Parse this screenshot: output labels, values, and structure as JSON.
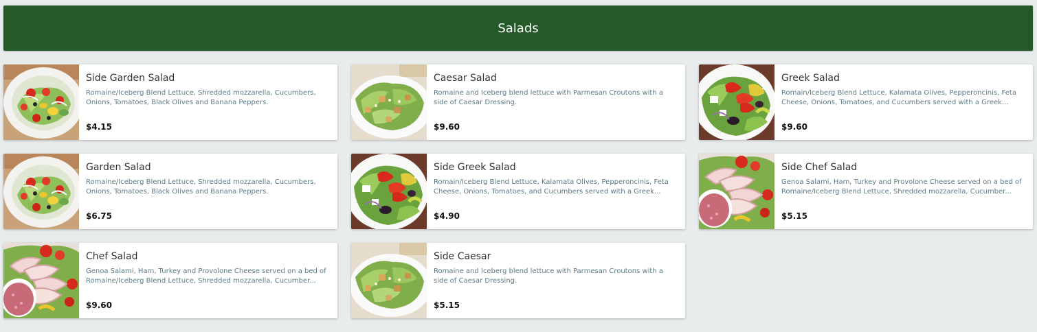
{
  "header": {
    "title": "Salads"
  },
  "items": [
    {
      "name": "Side Garden Salad",
      "description": "Romaine/Iceberg Blend Lettuce, Shredded mozzarella, Cucumbers, Onions, Tomatoes, Black Olives and Banana Peppers.",
      "price": "$4.15",
      "image": "garden-salad-image"
    },
    {
      "name": "Caesar Salad",
      "description": "Romaine and Iceberg blend lettuce with Parmesan Croutons with a side of Caesar Dressing.",
      "price": "$9.60",
      "image": "caesar-salad-image"
    },
    {
      "name": "Greek Salad",
      "description": "Romain/Iceberg Blend Lettuce, Kalamata Olives, Pepperoncinis, Feta Cheese, Onions, Tomatoes, and Cucumbers served with a Greek...",
      "price": "$9.60",
      "image": "greek-salad-image"
    },
    {
      "name": "Garden Salad",
      "description": "Romaine/Iceberg Blend Lettuce, Shredded mozzarella, Cucumbers, Onions, Tomatoes, Black Olives and Banana Peppers.",
      "price": "$6.75",
      "image": "garden-salad-image"
    },
    {
      "name": "Side Greek Salad",
      "description": "Romain/Iceberg Blend Lettuce, Kalamata Olives, Pepperoncinis, Feta Cheese, Onions, Tomatoes, and Cucumbers served with a Greek...",
      "price": "$4.90",
      "image": "greek-salad-image"
    },
    {
      "name": "Side Chef Salad",
      "description": "Genoa Salami, Ham, Turkey and Provolone Cheese served on a bed of Romaine/Iceberg Blend Lettuce, Shredded mozzarella, Cucumber...",
      "price": "$5.15",
      "image": "chef-salad-image"
    },
    {
      "name": "Chef Salad",
      "description": "Genoa Salami, Ham, Turkey and Provolone Cheese served on a bed of Romaine/Iceberg Blend Lettuce, Shredded mozzarella, Cucumber...",
      "price": "$9.60",
      "image": "chef-salad-image"
    },
    {
      "name": "Side Caesar",
      "description": "Romaine and Iceberg blend lettuce with Parmesan Croutons with a side of Caesar Dressing.",
      "price": "$5.15",
      "image": "caesar-salad-image"
    }
  ],
  "colors": {
    "header_bg": "#245a27",
    "page_bg": "#e9ecec",
    "description_text": "#5b7a86"
  }
}
